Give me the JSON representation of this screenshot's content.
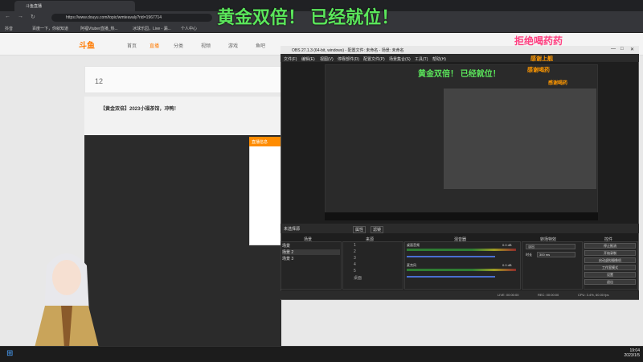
{
  "overlay": {
    "title": "黄金双倍！ 已经就位！",
    "sticker": "拒绝喝药药",
    "sticker2": "感谢上舰",
    "sticker3": "感谢喝药",
    "sticker4": "感谢喝药"
  },
  "browser": {
    "tab_title": "斗鱼直播",
    "url": "https://www.douyu.com/topic/wmteavaly?rid=1967714",
    "bookmarks": [
      "抖音",
      "百度一下，你就知道",
      "阿福Vtuber直播_热...",
      "冰球乐园，Live - 漏...",
      "个人中心"
    ]
  },
  "douyu": {
    "logo": "斗鱼",
    "nav": [
      "首页",
      "直播",
      "分类",
      "视频",
      "游戏",
      "鱼吧"
    ],
    "room_title": "【黄金双倍】2023小福茶馆，冲鸭！",
    "follow_count": "12",
    "dialog_title": "直播信息"
  },
  "obs": {
    "title": "OBS 27.1.3 (64-bit, windows) - 配置文件: 未命名 - 场景: 未命名",
    "menu": [
      "文件(F)",
      "编辑(E)",
      "视图(V)",
      "停靠部件(D)",
      "配置文件(P)",
      "场景集合(S)",
      "工具(T)",
      "帮助(H)"
    ],
    "preview_title": "黄金双倍！ 已经就位！",
    "scene_label": "未选择源",
    "scene_tabs": [
      "属性",
      "滤镜"
    ],
    "dock_titles": [
      "场景",
      "来源",
      "混音器",
      "转场特效",
      "控件"
    ],
    "scenes": [
      "场景",
      "场景 2",
      "场景 3"
    ],
    "sources": [
      "1",
      "2",
      "3",
      "4",
      "5",
      "桌面"
    ],
    "mixer": [
      {
        "name": "桌面音频",
        "level": "0.0 dB"
      },
      {
        "name": "麦克风",
        "level": "0.0 dB"
      }
    ],
    "transition": {
      "type": "淡出",
      "duration_label": "时长",
      "duration": "300 ms"
    },
    "controls": [
      "停止推流",
      "开始录制",
      "启动虚拟摄像机",
      "工作室模式",
      "设置",
      "退出"
    ],
    "status": {
      "live": "LIVE: 00:00:00",
      "rec": "REC: 00:00:00",
      "cpu": "CPU: 3.4%, 60.00 fps"
    }
  },
  "taskbar": {
    "time": "19:04",
    "date": "2023/1/5"
  },
  "colors": {
    "accent": "#ff7a00",
    "overlay_text": "#5be65b",
    "obs_bg": "#1e1e1e"
  }
}
